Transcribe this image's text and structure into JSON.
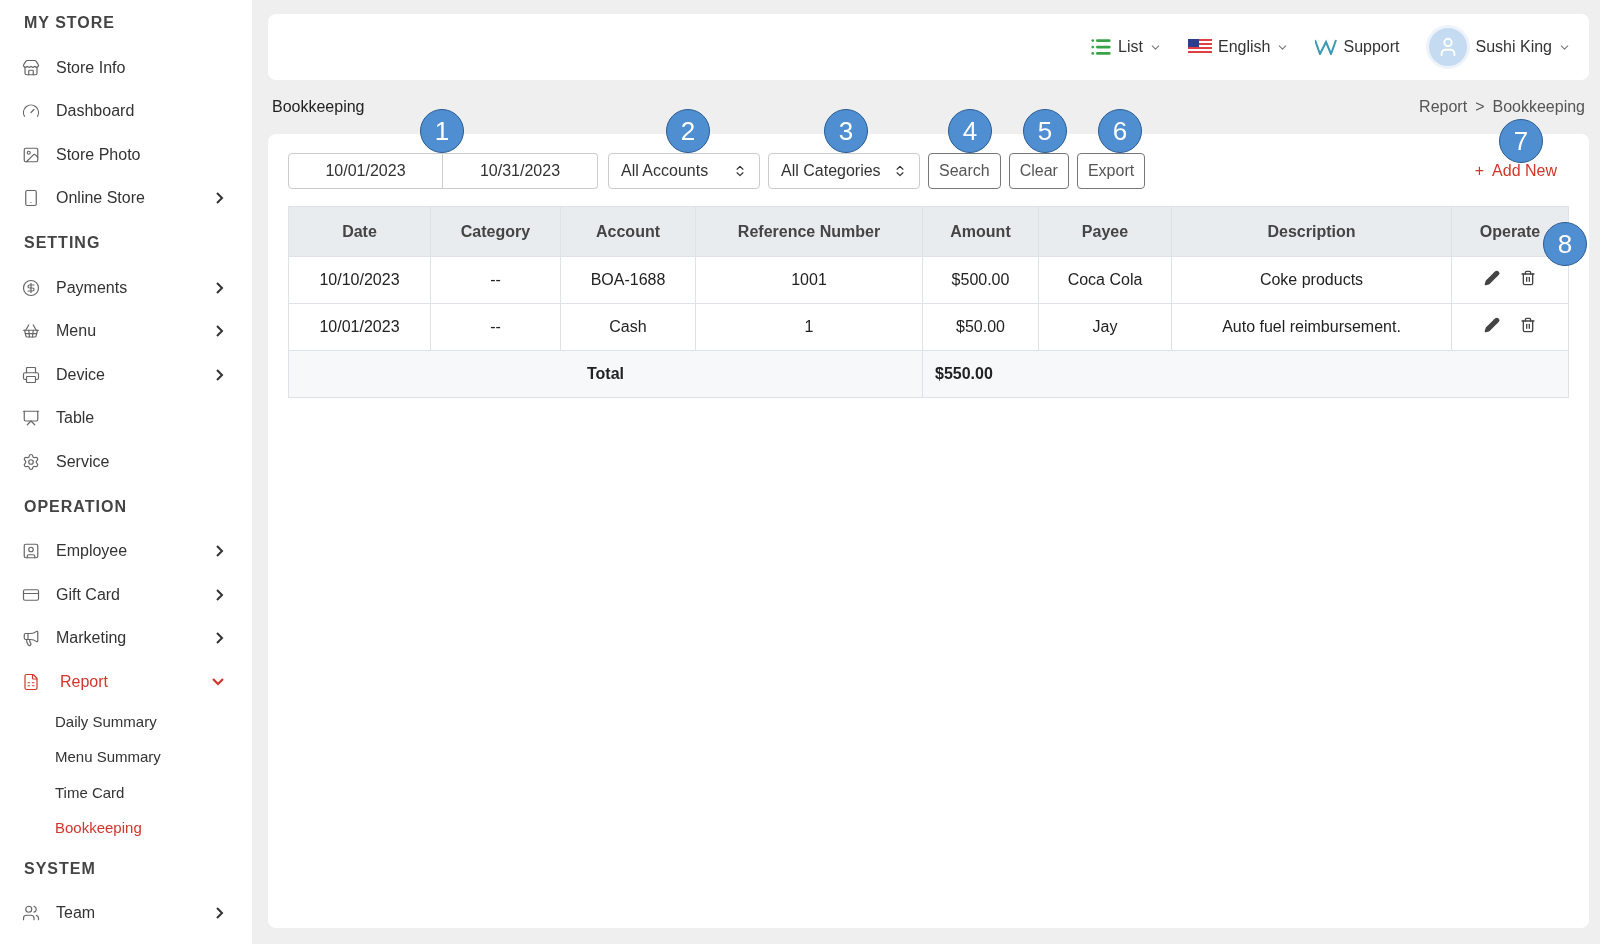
{
  "sidebar": {
    "sections": [
      {
        "title": "MY STORE",
        "items": [
          {
            "label": "Store Info",
            "expandable": false,
            "expanded": false,
            "selected": false
          },
          {
            "label": "Dashboard",
            "expandable": false,
            "expanded": false,
            "selected": false
          },
          {
            "label": "Store Photo",
            "expandable": false,
            "expanded": false,
            "selected": false
          },
          {
            "label": "Online Store",
            "expandable": true,
            "expanded": false,
            "selected": false
          }
        ]
      },
      {
        "title": "SETTING",
        "items": [
          {
            "label": "Payments",
            "expandable": true,
            "expanded": false,
            "selected": false
          },
          {
            "label": "Menu",
            "expandable": true,
            "expanded": false,
            "selected": false
          },
          {
            "label": "Device",
            "expandable": true,
            "expanded": false,
            "selected": false
          },
          {
            "label": "Table",
            "expandable": false,
            "expanded": false,
            "selected": false
          },
          {
            "label": "Service",
            "expandable": false,
            "expanded": false,
            "selected": false
          }
        ]
      },
      {
        "title": "OPERATION",
        "items": [
          {
            "label": "Employee",
            "expandable": true,
            "expanded": false,
            "selected": false
          },
          {
            "label": "Gift Card",
            "expandable": true,
            "expanded": false,
            "selected": false
          },
          {
            "label": "Marketing",
            "expandable": true,
            "expanded": false,
            "selected": false
          },
          {
            "label": "Report",
            "expandable": true,
            "expanded": true,
            "selected": true,
            "children": [
              {
                "label": "Daily Summary",
                "selected": false
              },
              {
                "label": "Menu Summary",
                "selected": false
              },
              {
                "label": "Time Card",
                "selected": false
              },
              {
                "label": "Bookkeeping",
                "selected": true
              }
            ]
          }
        ]
      },
      {
        "title": "SYSTEM",
        "items": [
          {
            "label": "Team",
            "expandable": true,
            "expanded": false,
            "selected": false
          }
        ]
      }
    ]
  },
  "topbar": {
    "view": "List",
    "language": "English",
    "support": "Support",
    "user": "Sushi King"
  },
  "page_title": "Bookkeeping",
  "breadcrumb": [
    "Report",
    ">",
    "Bookkeeping"
  ],
  "filters": {
    "date_from": "10/01/2023",
    "date_to": "10/31/2023",
    "account": "All Accounts",
    "category": "All Categories",
    "buttons": [
      "Search",
      "Clear",
      "Export"
    ],
    "add_new": "Add New",
    "add_icon": "+"
  },
  "table": {
    "columns": [
      "Date",
      "Category",
      "Account",
      "Reference Number",
      "Amount",
      "Payee",
      "Description",
      "Operate"
    ],
    "rows": [
      [
        "10/10/2023",
        "--",
        "BOA-1688",
        "1001",
        "$500.00",
        "Coca Cola",
        "Coke products"
      ],
      [
        "10/01/2023",
        "--",
        "Cash",
        "1",
        "$50.00",
        "Jay",
        "Auto fuel reimbursement."
      ]
    ],
    "total": {
      "label": "Total",
      "amount": "$550.00"
    }
  },
  "callouts": [
    "1",
    "2",
    "3",
    "4",
    "5",
    "6",
    "7",
    "8"
  ]
}
